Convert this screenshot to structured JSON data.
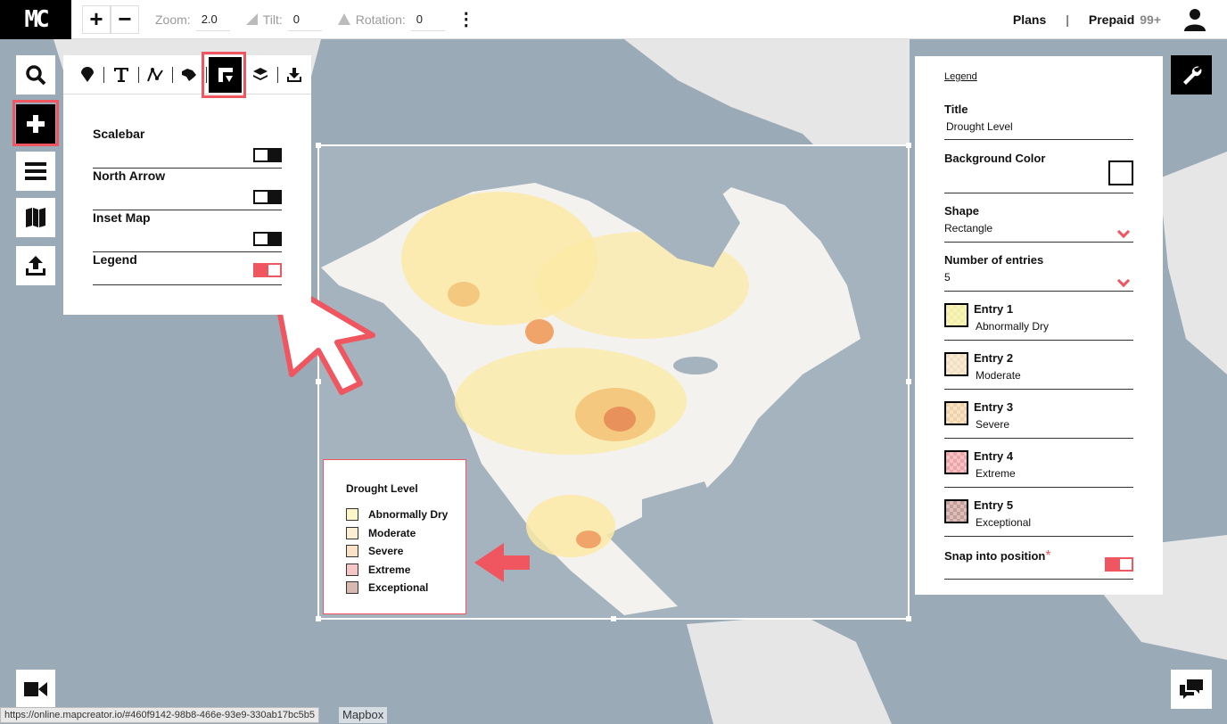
{
  "app": {
    "logo_text": "MC"
  },
  "topbar": {
    "zoom_label": "Zoom:",
    "zoom_value": "2.0",
    "tilt_label": "Tilt:",
    "tilt_value": "0",
    "rotation_label": "Rotation:",
    "rotation_value": "0",
    "plans_label": "Plans",
    "separator": "|",
    "prepaid_label": "Prepaid",
    "prepaid_credits": "99+"
  },
  "toolpanel": {
    "tabs": [
      {
        "name": "marker-icon"
      },
      {
        "name": "text-icon"
      },
      {
        "name": "route-icon"
      },
      {
        "name": "area-icon"
      },
      {
        "name": "map-elements-icon",
        "active": true
      },
      {
        "name": "layers-icon"
      },
      {
        "name": "download-icon"
      }
    ],
    "options": [
      {
        "label": "Scalebar",
        "on": false
      },
      {
        "label": "North Arrow",
        "on": false
      },
      {
        "label": "Inset Map",
        "on": false
      },
      {
        "label": "Legend",
        "on": true
      }
    ]
  },
  "map_legend": {
    "title": "Drought Level",
    "items": [
      {
        "label": "Abnormally Dry",
        "color": "#fdf6c8"
      },
      {
        "label": "Moderate",
        "color": "#fbeed5"
      },
      {
        "label": "Severe",
        "color": "#fbe1c6"
      },
      {
        "label": "Extreme",
        "color": "#f6c6c6"
      },
      {
        "label": "Exceptional",
        "color": "#d9b8b0"
      }
    ]
  },
  "rightpanel": {
    "header": "Legend",
    "title_label": "Title",
    "title_value": "Drought Level",
    "bg_color_label": "Background Color",
    "shape_label": "Shape",
    "shape_value": "Rectangle",
    "entries_label": "Number of entries",
    "entries_value": "5",
    "entries": [
      {
        "name": "Entry 1",
        "value": "Abnormally Dry",
        "color": "#f4eea0"
      },
      {
        "name": "Entry 2",
        "value": "Moderate",
        "color": "#f3dfc0"
      },
      {
        "name": "Entry 3",
        "value": "Severe",
        "color": "#f1d2a8"
      },
      {
        "name": "Entry 4",
        "value": "Extreme",
        "color": "#eda3a8"
      },
      {
        "name": "Entry 5",
        "value": "Exceptional",
        "color": "#c79d98"
      }
    ],
    "snap_label": "Snap into position",
    "snap_asterisk": "*"
  },
  "status": {
    "url": "https://online.mapcreator.io/#460f9142-98b8-466e-93e9-330ab17bc5b5",
    "attribution": "Mapbox"
  },
  "colors": {
    "accent": "#f0565f",
    "ocean": "#9aaab7",
    "land": "#e6e6e6",
    "drought_light": "#fbeaa6",
    "drought_mid": "#f5c880",
    "drought_dark": "#e8915a"
  }
}
